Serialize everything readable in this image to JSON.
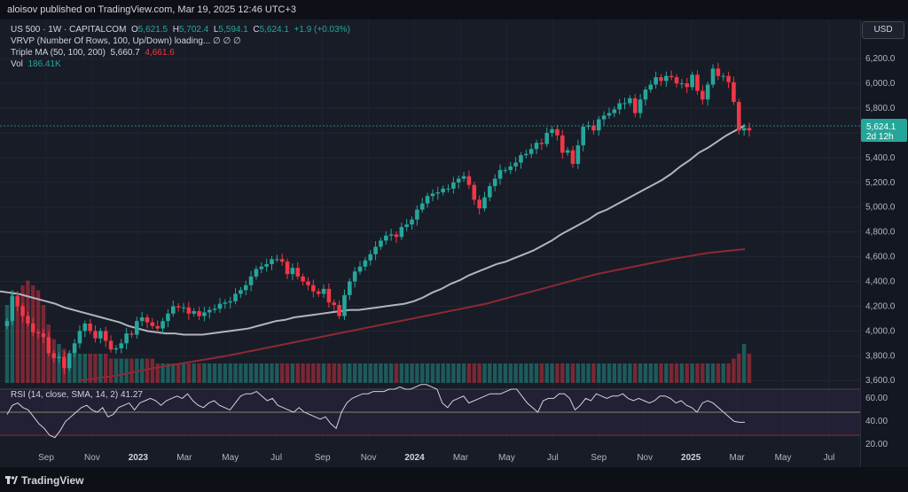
{
  "header": {
    "title": "aloisov published on TradingView.com, Mar 19, 2025 12:46 UTC+3"
  },
  "legend": {
    "symbol": "US 500 · 1W · CAPITALCOM",
    "ohlc": [
      {
        "k": "O",
        "v": "5,621.5"
      },
      {
        "k": "H",
        "v": "5,702.4"
      },
      {
        "k": "L",
        "v": "5,594.1"
      },
      {
        "k": "C",
        "v": "5,624.1"
      }
    ],
    "change": "+1.9 (+0.03%)",
    "vrvp": "VRVP (Number Of Rows, 100, Up/Down) loading...  ∅  ∅  ∅",
    "ma_label": "Triple MA (50, 100, 200)",
    "ma_val1": "5,660.7",
    "ma_val2": "4,661.6",
    "vol_label": "Vol",
    "vol_val": "186.41K",
    "rsi": "RSI (14, close, SMA, 14, 2)",
    "rsi_val": "41.27"
  },
  "axis": {
    "currency_button": "USD",
    "price_badge": "5,624.1",
    "countdown": "2d 12h"
  },
  "footer": {
    "brand": "TradingView"
  },
  "colors": {
    "up": "#26a69a",
    "down": "#f23645",
    "ma50": "#b2b5be",
    "ma200": "#8b2a33",
    "rsi_line": "#d1d4dc",
    "rsi_band": "#2a2440"
  },
  "chart_data": {
    "type": "candlestick",
    "interval": "1W",
    "price_axis": {
      "ticks": [
        "6,200.0",
        "6,000.0",
        "5,800.0",
        "5,600.0",
        "5,400.0",
        "5,200.0",
        "5,000.0",
        "4,800.0",
        "4,600.0",
        "4,400.0",
        "4,200.0",
        "4,000.0",
        "3,800.0",
        "3,600.0"
      ],
      "range": [
        3580,
        6330
      ]
    },
    "time_axis": {
      "ticks": [
        "Sep",
        "Nov",
        "2023",
        "Mar",
        "May",
        "Jul",
        "Sep",
        "Nov",
        "2024",
        "Mar",
        "May",
        "Jul",
        "Sep",
        "Nov",
        "2025",
        "Mar",
        "May",
        "Jul"
      ]
    },
    "rsi_axis": {
      "ticks": [
        "60.00",
        "40.00",
        "20.00"
      ],
      "range": [
        15,
        70
      ],
      "upper": 70,
      "middle": 50,
      "lower": 30
    },
    "weekly_close": [
      4080,
      4280,
      4200,
      4120,
      4060,
      3990,
      3980,
      3950,
      3820,
      3780,
      3790,
      3700,
      3820,
      3900,
      4000,
      4060,
      4000,
      3940,
      4000,
      3920,
      3850,
      3860,
      3900,
      3980,
      3970,
      4080,
      4110,
      4070,
      4040,
      4020,
      4080,
      4140,
      4200,
      4190,
      4190,
      4140,
      4160,
      4120,
      4150,
      4170,
      4180,
      4220,
      4230,
      4240,
      4300,
      4330,
      4370,
      4440,
      4500,
      4520,
      4540,
      4580,
      4580,
      4560,
      4460,
      4510,
      4440,
      4400,
      4370,
      4320,
      4300,
      4340,
      4230,
      4210,
      4120,
      4290,
      4400,
      4480,
      4520,
      4570,
      4620,
      4680,
      4730,
      4770,
      4780,
      4760,
      4840,
      4860,
      4900,
      4980,
      5030,
      5090,
      5110,
      5120,
      5150,
      5150,
      5200,
      5230,
      5250,
      5180,
      5060,
      4990,
      5080,
      5170,
      5230,
      5300,
      5300,
      5330,
      5360,
      5420,
      5430,
      5470,
      5520,
      5510,
      5600,
      5630,
      5580,
      5440,
      5460,
      5350,
      5500,
      5650,
      5660,
      5620,
      5710,
      5740,
      5760,
      5790,
      5840,
      5840,
      5880,
      5760,
      5870,
      5950,
      5990,
      6050,
      6020,
      6060,
      6050,
      6000,
      6000,
      5970,
      6070,
      5940,
      5870,
      5990,
      6120,
      6060,
      6060,
      6010,
      5850,
      5620,
      5640,
      5620
    ],
    "ma50_close": [
      4320,
      4310,
      4300,
      4280,
      4260,
      4240,
      4220,
      4190,
      4170,
      4150,
      4130,
      4110,
      4090,
      4070,
      4040,
      4020,
      4000,
      3990,
      3980,
      3980,
      3970,
      3970,
      3970,
      3980,
      3990,
      4000,
      4010,
      4020,
      4040,
      4060,
      4080,
      4090,
      4110,
      4120,
      4130,
      4140,
      4150,
      4160,
      4170,
      4170,
      4180,
      4190,
      4200,
      4210,
      4220,
      4240,
      4270,
      4310,
      4340,
      4380,
      4410,
      4450,
      4480,
      4510,
      4540,
      4560,
      4590,
      4620,
      4650,
      4690,
      4730,
      4780,
      4820,
      4860,
      4900,
      4950,
      4980,
      5020,
      5060,
      5100,
      5140,
      5180,
      5220,
      5270,
      5330,
      5380,
      5440,
      5480,
      5530,
      5580,
      5620,
      5660
    ],
    "ma200_close": [
      3600,
      3640,
      3700,
      3750,
      3800,
      3860,
      3920,
      3980,
      4040,
      4100,
      4160,
      4220,
      4300,
      4380,
      4460,
      4520,
      4580,
      4630,
      4661.6
    ],
    "rsi": [
      48,
      56,
      58,
      54,
      52,
      46,
      40,
      36,
      30,
      28,
      34,
      42,
      46,
      50,
      54,
      56,
      52,
      50,
      54,
      46,
      48,
      54,
      56,
      58,
      52,
      58,
      60,
      62,
      60,
      56,
      60,
      62,
      64,
      62,
      66,
      60,
      56,
      54,
      58,
      60,
      56,
      54,
      52,
      58,
      64,
      66,
      66,
      68,
      64,
      60,
      62,
      56,
      54,
      52,
      50,
      54,
      50,
      48,
      46,
      44,
      46,
      40,
      36,
      50,
      58,
      62,
      64,
      66,
      66,
      68,
      68,
      68,
      70,
      70,
      72,
      70,
      70,
      72,
      74,
      74,
      72,
      70,
      58,
      54,
      60,
      62,
      64,
      58,
      60,
      62,
      64,
      66,
      66,
      66,
      68,
      70,
      70,
      64,
      58,
      54,
      50,
      60,
      62,
      62,
      66,
      66,
      62,
      52,
      56,
      62,
      60,
      66,
      64,
      62,
      64,
      64,
      66,
      62,
      60,
      62,
      60,
      58,
      60,
      64,
      64,
      62,
      58,
      60,
      56,
      54,
      50,
      58,
      60,
      58,
      54,
      50,
      46,
      42,
      41.27,
      41.27
    ],
    "volume": [
      160,
      190,
      180,
      200,
      210,
      200,
      190,
      160,
      120,
      90,
      80,
      70,
      60,
      60,
      60,
      60,
      60,
      60,
      60,
      60,
      50,
      50,
      50,
      50,
      50,
      50,
      50,
      50,
      50,
      40,
      40,
      40,
      40,
      40,
      40,
      40,
      40,
      40,
      40,
      40,
      40,
      40,
      40,
      40,
      40,
      40,
      40,
      40,
      40,
      40,
      40,
      40,
      40,
      40,
      40,
      40,
      40,
      40,
      40,
      40,
      40,
      40,
      40,
      40,
      40,
      40,
      40,
      40,
      40,
      40,
      40,
      40,
      40,
      40,
      40,
      40,
      40,
      40,
      40,
      40,
      40,
      40,
      40,
      40,
      40,
      40,
      40,
      40,
      40,
      40,
      40,
      40,
      40,
      40,
      40,
      40,
      40,
      40,
      40,
      40,
      40,
      40,
      40,
      40,
      40,
      40,
      40,
      40,
      40,
      40,
      40,
      40,
      40,
      40,
      40,
      40,
      40,
      40,
      40,
      40,
      40,
      40,
      40,
      40,
      40,
      40,
      40,
      40,
      40,
      40,
      40,
      40,
      40,
      40,
      40,
      40,
      40,
      40,
      40,
      40,
      50,
      60,
      80,
      60
    ]
  }
}
